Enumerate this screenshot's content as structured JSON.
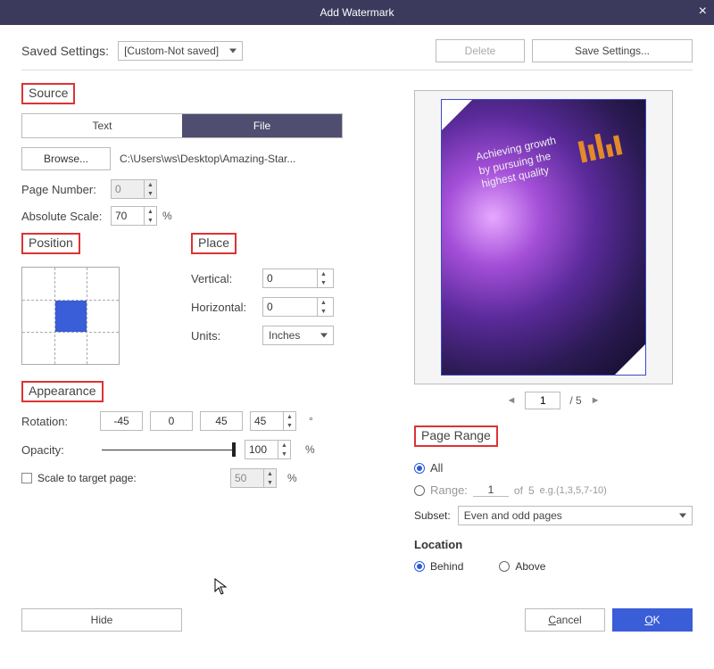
{
  "title": "Add Watermark",
  "saved": {
    "label": "Saved Settings:",
    "value": "[Custom-Not saved]",
    "delete": "Delete",
    "save": "Save Settings..."
  },
  "source": {
    "title": "Source",
    "tab_text": "Text",
    "tab_file": "File",
    "browse": "Browse...",
    "path": "C:\\Users\\ws\\Desktop\\Amazing-Star...",
    "page_number_label": "Page Number:",
    "page_number": "0",
    "abs_scale_label": "Absolute Scale:",
    "abs_scale": "70",
    "pct": "%"
  },
  "position": {
    "title": "Position"
  },
  "place": {
    "title": "Place",
    "vertical_label": "Vertical:",
    "vertical": "0",
    "horizontal_label": "Horizontal:",
    "horizontal": "0",
    "units_label": "Units:",
    "units": "Inches"
  },
  "appearance": {
    "title": "Appearance",
    "rotation_label": "Rotation:",
    "btn_neg45": "-45",
    "btn_0": "0",
    "btn_45": "45",
    "rotation": "45",
    "deg": "°",
    "opacity_label": "Opacity:",
    "opacity": "100",
    "pct": "%",
    "scale_label": "Scale to target page:",
    "scale": "50"
  },
  "preview": {
    "page": "1",
    "total": "/ 5",
    "headline1": "Achieving growth",
    "headline2": "by pursuing the",
    "headline3": "highest quality"
  },
  "pagerange": {
    "title": "Page Range",
    "all": "All",
    "range": "Range:",
    "range_from": "1",
    "of": "of",
    "total": "5",
    "hint": "e.g.(1,3,5,7-10)",
    "subset_label": "Subset:",
    "subset": "Even and odd pages"
  },
  "location": {
    "title": "Location",
    "behind": "Behind",
    "above": "Above"
  },
  "footer": {
    "hide": "Hide",
    "cancel": "Cancel",
    "ok": "OK"
  }
}
